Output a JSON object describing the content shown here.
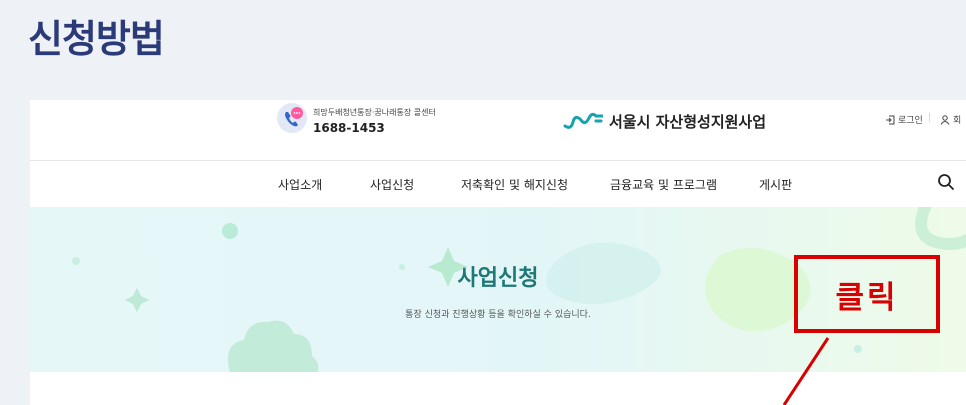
{
  "page_title": "신청방법",
  "header": {
    "hotline_label": "희망두배청년통장·꿈나래통장 콜센터",
    "hotline_number": "1688-1453",
    "logo_title": "서울시 자산형성지원사업",
    "login_label": "로그인",
    "signup_label": "회"
  },
  "nav": {
    "items": [
      "사업소개",
      "사업신청",
      "저축확인 및 해지신청",
      "금융교육 및 프로그램",
      "게시판"
    ]
  },
  "hero": {
    "title": "사업신청",
    "subtitle": "통장 신청과 진행상황 등을 확인하실 수 있습니다."
  },
  "annotation": {
    "label": "클릭",
    "color": "#d80000"
  },
  "colors": {
    "page_title": "#2b3a78",
    "hero_title": "#1d7876",
    "logo_accent": "#15a3b0"
  }
}
